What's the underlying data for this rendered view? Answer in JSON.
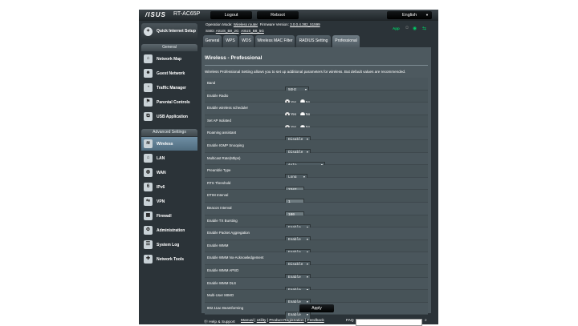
{
  "header": {
    "logo": "/ISUS",
    "model": "RT-AC65P",
    "logout": "Logout",
    "reboot": "Reboot",
    "language": "English",
    "op_mode_label": "Operation Mode:",
    "op_mode_value": "Wireless router",
    "fw_label": "Firmware Version:",
    "fw_value": "3.0.0.4.382_51599",
    "ssid_label": "SSID:",
    "ssid_1": "ASUS_B8_2G",
    "ssid_2": "ASUS_B8_5G",
    "app_label": "App"
  },
  "sidebar": {
    "quick_setup": "Quick Internet Setup",
    "general_head": "General",
    "general_items": [
      "Network Map",
      "Guest Network",
      "Traffic Manager",
      "Parental Controls",
      "USB Application"
    ],
    "advanced_head": "Advanced Settings",
    "advanced_items": [
      "Wireless",
      "LAN",
      "WAN",
      "IPv6",
      "VPN",
      "Firewall",
      "Administration",
      "System Log",
      "Network Tools"
    ]
  },
  "tabs": [
    "General",
    "WPS",
    "WDS",
    "Wireless MAC Filter",
    "RADIUS Setting",
    "Professional"
  ],
  "main": {
    "title": "Wireless - Professional",
    "description": "Wireless Professional Setting allows you to set up additional parameters for wireless. But default values are recommended.",
    "apply": "Apply",
    "yes": "Yes",
    "no": "No",
    "rows": [
      {
        "label": "Band",
        "type": "select",
        "value": "5GHz"
      },
      {
        "label": "Enable Radio",
        "type": "radio",
        "value": "Yes"
      },
      {
        "label": "Enable wireless scheduler",
        "type": "radio",
        "value": "Yes"
      },
      {
        "label": "Set AP Isolated",
        "type": "radio",
        "value": "Yes"
      },
      {
        "label": "Roaming assistant",
        "type": "select",
        "value": "Disable"
      },
      {
        "label": "Enable IGMP Snooping",
        "type": "select",
        "value": "Disable"
      },
      {
        "label": "Multicast Rate(Mbps)",
        "type": "select",
        "value": "Auto"
      },
      {
        "label": "Preamble Type",
        "type": "select",
        "value": "Long"
      },
      {
        "label": "RTS Threshold",
        "type": "text",
        "value": "2347"
      },
      {
        "label": "DTIM Interval",
        "type": "text",
        "value": "1"
      },
      {
        "label": "Beacon Interval",
        "type": "text",
        "value": "100"
      },
      {
        "label": "Enable TX Bursting",
        "type": "select",
        "value": "Enable"
      },
      {
        "label": "Enable Packet Aggregation",
        "type": "select",
        "value": "Enable"
      },
      {
        "label": "Enable WMM",
        "type": "select",
        "value": "Enable"
      },
      {
        "label": "Enable WMM No-Acknowledgement",
        "type": "select",
        "value": "Disable"
      },
      {
        "label": "Enable WMM APSD",
        "type": "select",
        "value": "Enable"
      },
      {
        "label": "Enable WMM DLS",
        "type": "select",
        "value": "Enable"
      },
      {
        "label": "Multi-User MIMO",
        "type": "select",
        "value": "Enable"
      },
      {
        "label": "802.11ac Beamforming",
        "type": "select",
        "value": "Enable"
      }
    ]
  },
  "footer": {
    "help": "Help & Support",
    "manual": "Manual",
    "utility": "Utility",
    "product_registration": "Product Registration",
    "feedback": "Feedback",
    "faq": "FAQ"
  }
}
